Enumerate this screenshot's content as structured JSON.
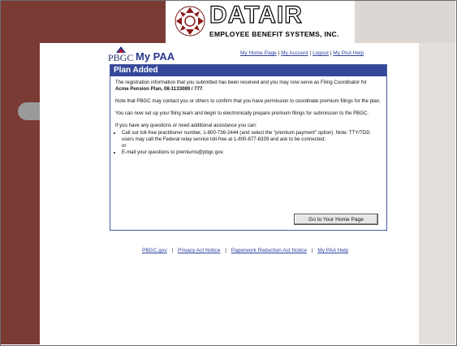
{
  "brand": {
    "company_name": "DATAIR",
    "company_tagline": "EMPLOYEE BENEFIT SYSTEMS, INC.",
    "app_logo_prefix": "PBGC",
    "app_name": "My PAA"
  },
  "top_nav": {
    "links": [
      "My Home Page",
      "My Account",
      "Logout",
      "My PAA Help"
    ],
    "separator": "|"
  },
  "panel": {
    "title": "Plan Added",
    "para1_before": "The registration information that you submitted has been received and you may now serve as Filing Coordinator for ",
    "para1_plan": "Acme Pension Plan, 08-1133089 / 777",
    "para1_after": ".",
    "para2": "Note that PBGC may contact you or others to confirm that you have permission to coordinate premium filings for the plan.",
    "para3": "You can now set up your filing team and begin to electronically prepare premium filings for submission to the PBGC.",
    "para4": "If you have any questions or need additional assistance you can:",
    "bullet1": "Call our toll-free practitioner number, 1-800-736-2444 (and select the \"premium payment\" option). Note: TTY/TDD users may call the Federal relay service toll-free at 1-800-877-8339 and ask to be connected;",
    "bullet1_tail": "or",
    "bullet2_before": "E-mail your questions to ",
    "bullet2_email": "premiums@pbgc.gov",
    "bullet2_after": ".",
    "home_button": "Go to Your Home Page"
  },
  "footer": {
    "links": [
      "PBGC.gov",
      "Privacy Act Notice",
      "Paperwork Reduction Act Notice",
      "My PAA Help"
    ],
    "separator": "|"
  },
  "colors": {
    "maroon": "#7a3b34",
    "panel_header": "#35479a",
    "link": "#3040a0"
  }
}
